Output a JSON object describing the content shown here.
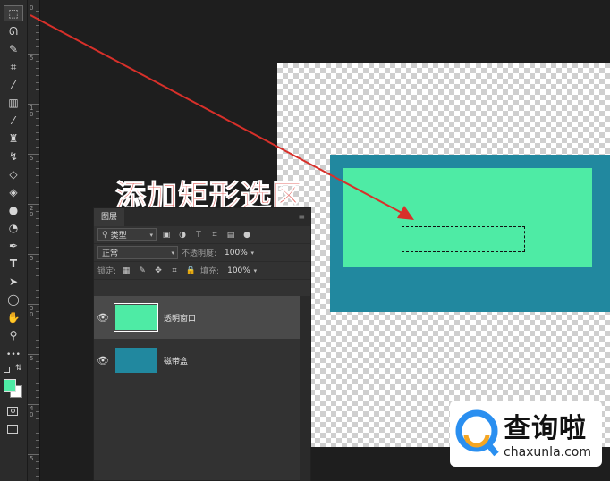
{
  "toolbar": {
    "tools": [
      {
        "name": "rect-marquee-tool",
        "glyph": "⬚",
        "active": true
      },
      {
        "name": "lasso-tool",
        "glyph": "ᘏ"
      },
      {
        "name": "quick-select-tool",
        "glyph": "✎"
      },
      {
        "name": "crop-tool",
        "glyph": "⌗"
      },
      {
        "name": "eyedropper-tool",
        "glyph": "⁄"
      },
      {
        "name": "healing-brush-tool",
        "glyph": "▥"
      },
      {
        "name": "brush-tool",
        "glyph": "⁄"
      },
      {
        "name": "clone-stamp-tool",
        "glyph": "♜"
      },
      {
        "name": "history-brush-tool",
        "glyph": "↯"
      },
      {
        "name": "eraser-tool",
        "glyph": "◇"
      },
      {
        "name": "paint-bucket-tool",
        "glyph": "◈"
      },
      {
        "name": "blur-tool",
        "glyph": "●"
      },
      {
        "name": "dodge-tool",
        "glyph": "◔"
      },
      {
        "name": "pen-tool",
        "glyph": "✒"
      },
      {
        "name": "type-tool",
        "glyph": "T"
      },
      {
        "name": "path-select-tool",
        "glyph": "➤"
      },
      {
        "name": "shape-tool",
        "glyph": "◯"
      },
      {
        "name": "hand-tool",
        "glyph": "✋"
      },
      {
        "name": "zoom-tool",
        "glyph": "⚲"
      },
      {
        "name": "more-tools",
        "glyph": "•••"
      }
    ],
    "foreground_color": "#4eeba5",
    "background_color": "#ffffff"
  },
  "ruler": {
    "numbers": [
      "0",
      "5",
      "1\n0",
      "5",
      "2\n0",
      "5",
      "3\n0",
      "5",
      "4\n0",
      "5"
    ]
  },
  "annotation": {
    "text": "添加矩形选区",
    "color": "#d8302a"
  },
  "layers_panel": {
    "tab": "图层",
    "filter_kind": "类型",
    "blend_mode": "正常",
    "opacity_label": "不透明度:",
    "opacity_value": "100%",
    "lock_label": "锁定:",
    "fill_label": "填充:",
    "fill_value": "100%",
    "layers": [
      {
        "name": "透明窗口",
        "thumb_color": "#4eeba5",
        "selected": true
      },
      {
        "name": "磁带盒",
        "thumb_color": "#21889f",
        "selected": false
      }
    ]
  },
  "canvas": {
    "outer_color": "#21889f",
    "inner_color": "#4eeba5"
  },
  "watermark": {
    "cn": "查询啦",
    "en": "chaxunla.com",
    "small": "chaxunla.com"
  }
}
